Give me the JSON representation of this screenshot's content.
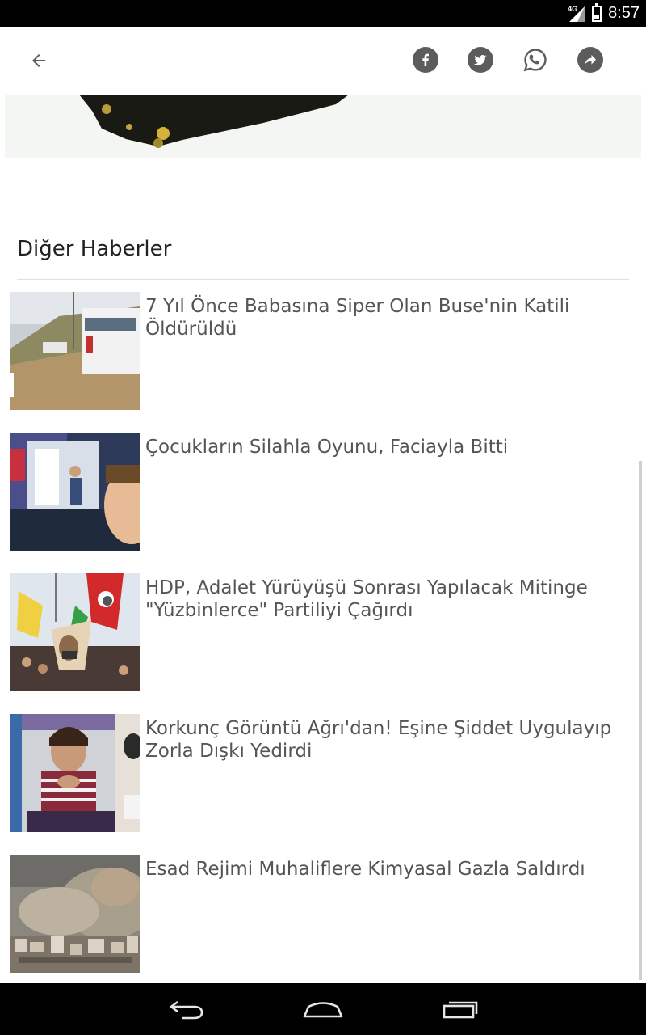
{
  "status_bar": {
    "time": "8:57",
    "network": "4G",
    "icons": [
      "signal-icon",
      "battery-icon"
    ]
  },
  "app_bar": {
    "back_icon": "arrow-back-icon",
    "share_icons": [
      "facebook-icon",
      "twitter-icon",
      "whatsapp-icon",
      "share-icon"
    ]
  },
  "section": {
    "title": "Diğer Haberler"
  },
  "news": [
    {
      "title": "7 Yıl Önce Babasına Siper Olan Buse'nin Katili Öldürüldü"
    },
    {
      "title": "Çocukların Silahla Oyunu, Faciayla Bitti"
    },
    {
      "title": "HDP, Adalet Yürüyüşü Sonrası Yapılacak Mitinge \"Yüzbinlerce\" Partiliyi Çağırdı"
    },
    {
      "title": "Korkunç Görüntü Ağrı'dan! Eşine Şiddet Uygulayıp Zorla Dışkı Yedirdi"
    },
    {
      "title": "Esad Rejimi Muhaliflere Kimyasal Gazla Saldırdı"
    }
  ],
  "nav_bar": {
    "icons": [
      "nav-back-icon",
      "nav-home-icon",
      "nav-recents-icon"
    ]
  },
  "colors": {
    "status_bar": "#000000",
    "icon_grey": "#5c5c5c",
    "title_text": "#555555",
    "heading_text": "#222222"
  }
}
